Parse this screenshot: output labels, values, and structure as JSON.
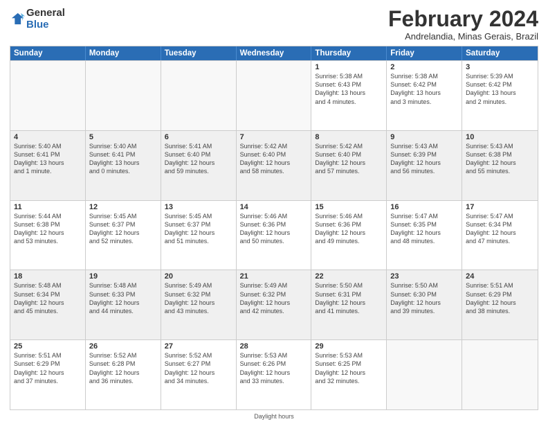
{
  "header": {
    "logo_line1": "General",
    "logo_line2": "Blue",
    "title": "February 2024",
    "location": "Andrelandia, Minas Gerais, Brazil"
  },
  "days_of_week": [
    "Sunday",
    "Monday",
    "Tuesday",
    "Wednesday",
    "Thursday",
    "Friday",
    "Saturday"
  ],
  "weeks": [
    [
      {
        "num": "",
        "info": "",
        "empty": true
      },
      {
        "num": "",
        "info": "",
        "empty": true
      },
      {
        "num": "",
        "info": "",
        "empty": true
      },
      {
        "num": "",
        "info": "",
        "empty": true
      },
      {
        "num": "1",
        "info": "Sunrise: 5:38 AM\nSunset: 6:43 PM\nDaylight: 13 hours\nand 4 minutes.",
        "empty": false
      },
      {
        "num": "2",
        "info": "Sunrise: 5:38 AM\nSunset: 6:42 PM\nDaylight: 13 hours\nand 3 minutes.",
        "empty": false
      },
      {
        "num": "3",
        "info": "Sunrise: 5:39 AM\nSunset: 6:42 PM\nDaylight: 13 hours\nand 2 minutes.",
        "empty": false
      }
    ],
    [
      {
        "num": "4",
        "info": "Sunrise: 5:40 AM\nSunset: 6:41 PM\nDaylight: 13 hours\nand 1 minute.",
        "empty": false
      },
      {
        "num": "5",
        "info": "Sunrise: 5:40 AM\nSunset: 6:41 PM\nDaylight: 13 hours\nand 0 minutes.",
        "empty": false
      },
      {
        "num": "6",
        "info": "Sunrise: 5:41 AM\nSunset: 6:40 PM\nDaylight: 12 hours\nand 59 minutes.",
        "empty": false
      },
      {
        "num": "7",
        "info": "Sunrise: 5:42 AM\nSunset: 6:40 PM\nDaylight: 12 hours\nand 58 minutes.",
        "empty": false
      },
      {
        "num": "8",
        "info": "Sunrise: 5:42 AM\nSunset: 6:40 PM\nDaylight: 12 hours\nand 57 minutes.",
        "empty": false
      },
      {
        "num": "9",
        "info": "Sunrise: 5:43 AM\nSunset: 6:39 PM\nDaylight: 12 hours\nand 56 minutes.",
        "empty": false
      },
      {
        "num": "10",
        "info": "Sunrise: 5:43 AM\nSunset: 6:38 PM\nDaylight: 12 hours\nand 55 minutes.",
        "empty": false
      }
    ],
    [
      {
        "num": "11",
        "info": "Sunrise: 5:44 AM\nSunset: 6:38 PM\nDaylight: 12 hours\nand 53 minutes.",
        "empty": false
      },
      {
        "num": "12",
        "info": "Sunrise: 5:45 AM\nSunset: 6:37 PM\nDaylight: 12 hours\nand 52 minutes.",
        "empty": false
      },
      {
        "num": "13",
        "info": "Sunrise: 5:45 AM\nSunset: 6:37 PM\nDaylight: 12 hours\nand 51 minutes.",
        "empty": false
      },
      {
        "num": "14",
        "info": "Sunrise: 5:46 AM\nSunset: 6:36 PM\nDaylight: 12 hours\nand 50 minutes.",
        "empty": false
      },
      {
        "num": "15",
        "info": "Sunrise: 5:46 AM\nSunset: 6:36 PM\nDaylight: 12 hours\nand 49 minutes.",
        "empty": false
      },
      {
        "num": "16",
        "info": "Sunrise: 5:47 AM\nSunset: 6:35 PM\nDaylight: 12 hours\nand 48 minutes.",
        "empty": false
      },
      {
        "num": "17",
        "info": "Sunrise: 5:47 AM\nSunset: 6:34 PM\nDaylight: 12 hours\nand 47 minutes.",
        "empty": false
      }
    ],
    [
      {
        "num": "18",
        "info": "Sunrise: 5:48 AM\nSunset: 6:34 PM\nDaylight: 12 hours\nand 45 minutes.",
        "empty": false
      },
      {
        "num": "19",
        "info": "Sunrise: 5:48 AM\nSunset: 6:33 PM\nDaylight: 12 hours\nand 44 minutes.",
        "empty": false
      },
      {
        "num": "20",
        "info": "Sunrise: 5:49 AM\nSunset: 6:32 PM\nDaylight: 12 hours\nand 43 minutes.",
        "empty": false
      },
      {
        "num": "21",
        "info": "Sunrise: 5:49 AM\nSunset: 6:32 PM\nDaylight: 12 hours\nand 42 minutes.",
        "empty": false
      },
      {
        "num": "22",
        "info": "Sunrise: 5:50 AM\nSunset: 6:31 PM\nDaylight: 12 hours\nand 41 minutes.",
        "empty": false
      },
      {
        "num": "23",
        "info": "Sunrise: 5:50 AM\nSunset: 6:30 PM\nDaylight: 12 hours\nand 39 minutes.",
        "empty": false
      },
      {
        "num": "24",
        "info": "Sunrise: 5:51 AM\nSunset: 6:29 PM\nDaylight: 12 hours\nand 38 minutes.",
        "empty": false
      }
    ],
    [
      {
        "num": "25",
        "info": "Sunrise: 5:51 AM\nSunset: 6:29 PM\nDaylight: 12 hours\nand 37 minutes.",
        "empty": false
      },
      {
        "num": "26",
        "info": "Sunrise: 5:52 AM\nSunset: 6:28 PM\nDaylight: 12 hours\nand 36 minutes.",
        "empty": false
      },
      {
        "num": "27",
        "info": "Sunrise: 5:52 AM\nSunset: 6:27 PM\nDaylight: 12 hours\nand 34 minutes.",
        "empty": false
      },
      {
        "num": "28",
        "info": "Sunrise: 5:53 AM\nSunset: 6:26 PM\nDaylight: 12 hours\nand 33 minutes.",
        "empty": false
      },
      {
        "num": "29",
        "info": "Sunrise: 5:53 AM\nSunset: 6:25 PM\nDaylight: 12 hours\nand 32 minutes.",
        "empty": false
      },
      {
        "num": "",
        "info": "",
        "empty": true
      },
      {
        "num": "",
        "info": "",
        "empty": true
      }
    ]
  ],
  "footer": "Daylight hours"
}
